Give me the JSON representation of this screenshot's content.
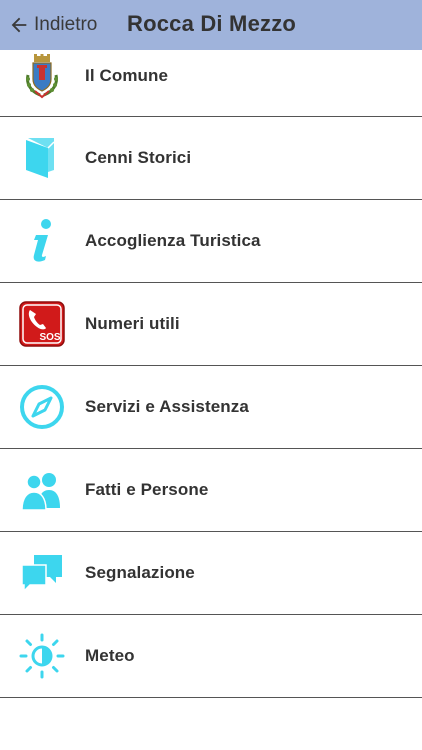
{
  "header": {
    "back_label": "Indietro",
    "title": "Rocca Di Mezzo",
    "background": "#9fb3db"
  },
  "accent_color": "#3dd6ee",
  "menu": {
    "items": [
      {
        "label": "Il Comune",
        "icon": "coat-of-arms-icon"
      },
      {
        "label": "Cenni Storici",
        "icon": "book-icon"
      },
      {
        "label": "Accoglienza Turistica",
        "icon": "info-icon"
      },
      {
        "label": "Numeri utili",
        "icon": "sos-phone-icon",
        "icon_text": "SOS"
      },
      {
        "label": "Servizi e Assistenza",
        "icon": "compass-icon"
      },
      {
        "label": "Fatti e Persone",
        "icon": "people-icon"
      },
      {
        "label": "Segnalazione",
        "icon": "chat-bubbles-icon"
      },
      {
        "label": "Meteo",
        "icon": "weather-icon"
      }
    ]
  }
}
